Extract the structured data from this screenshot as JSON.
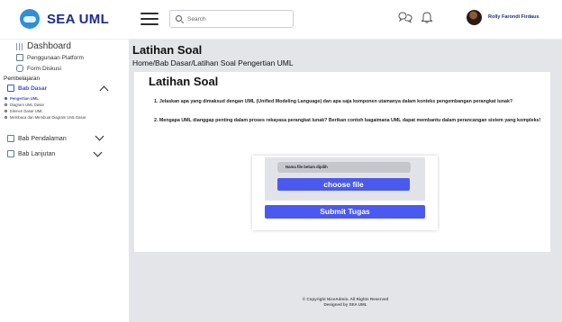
{
  "header": {
    "brand": "SEA UML",
    "search_placeholder": "Search",
    "username": "Rolly Farondi Firdaus"
  },
  "sidebar": {
    "dashboard": "Dashboard",
    "penggunaan_platform": "Penggunaan Platform",
    "form_diskusi": "Form Diskusi",
    "section_title": "Pembelajaran",
    "bab_dasar": "Bab Dasar",
    "sub_items": [
      "Pengertian UML",
      "Diagram UML Dasar",
      "Elemen Dasar UML",
      "Membaca dan Membuat Diagram UML Dasar"
    ],
    "bab_pendalaman": "Bab Pendalaman",
    "bab_lanjutan": "Bab Lanjutan"
  },
  "main": {
    "page_title": "Latihan Soal",
    "breadcrumb": "Home/Bab Dasar/Latihan Soal Pengertian UML",
    "card_title": "Latihan Soal",
    "questions": [
      "1. Jelaskan apa yang dimaksud dengan UML (Unified Modeling Language) dan apa saja komponen utamanya dalam konteks pengembangan perangkat lunak?",
      "2. Mengapa UML dianggap penting dalam proses rekayasa perangkat lunak? Berikan contoh bagaimana UML dapat membantu dalam perancangan sistem yang kompleks!"
    ],
    "file_status": "Nama file belum dipilih",
    "choose_file": "choose file",
    "submit": "Submit Tugas"
  },
  "footer": {
    "line1": "© Copyright NiceAdmin. All Rights Reserved",
    "line2": "Designed by SEA UML"
  },
  "colors": {
    "accent": "#4a59f0",
    "brand_text": "#1c2b8f",
    "main_bg": "#e4e5e9"
  }
}
